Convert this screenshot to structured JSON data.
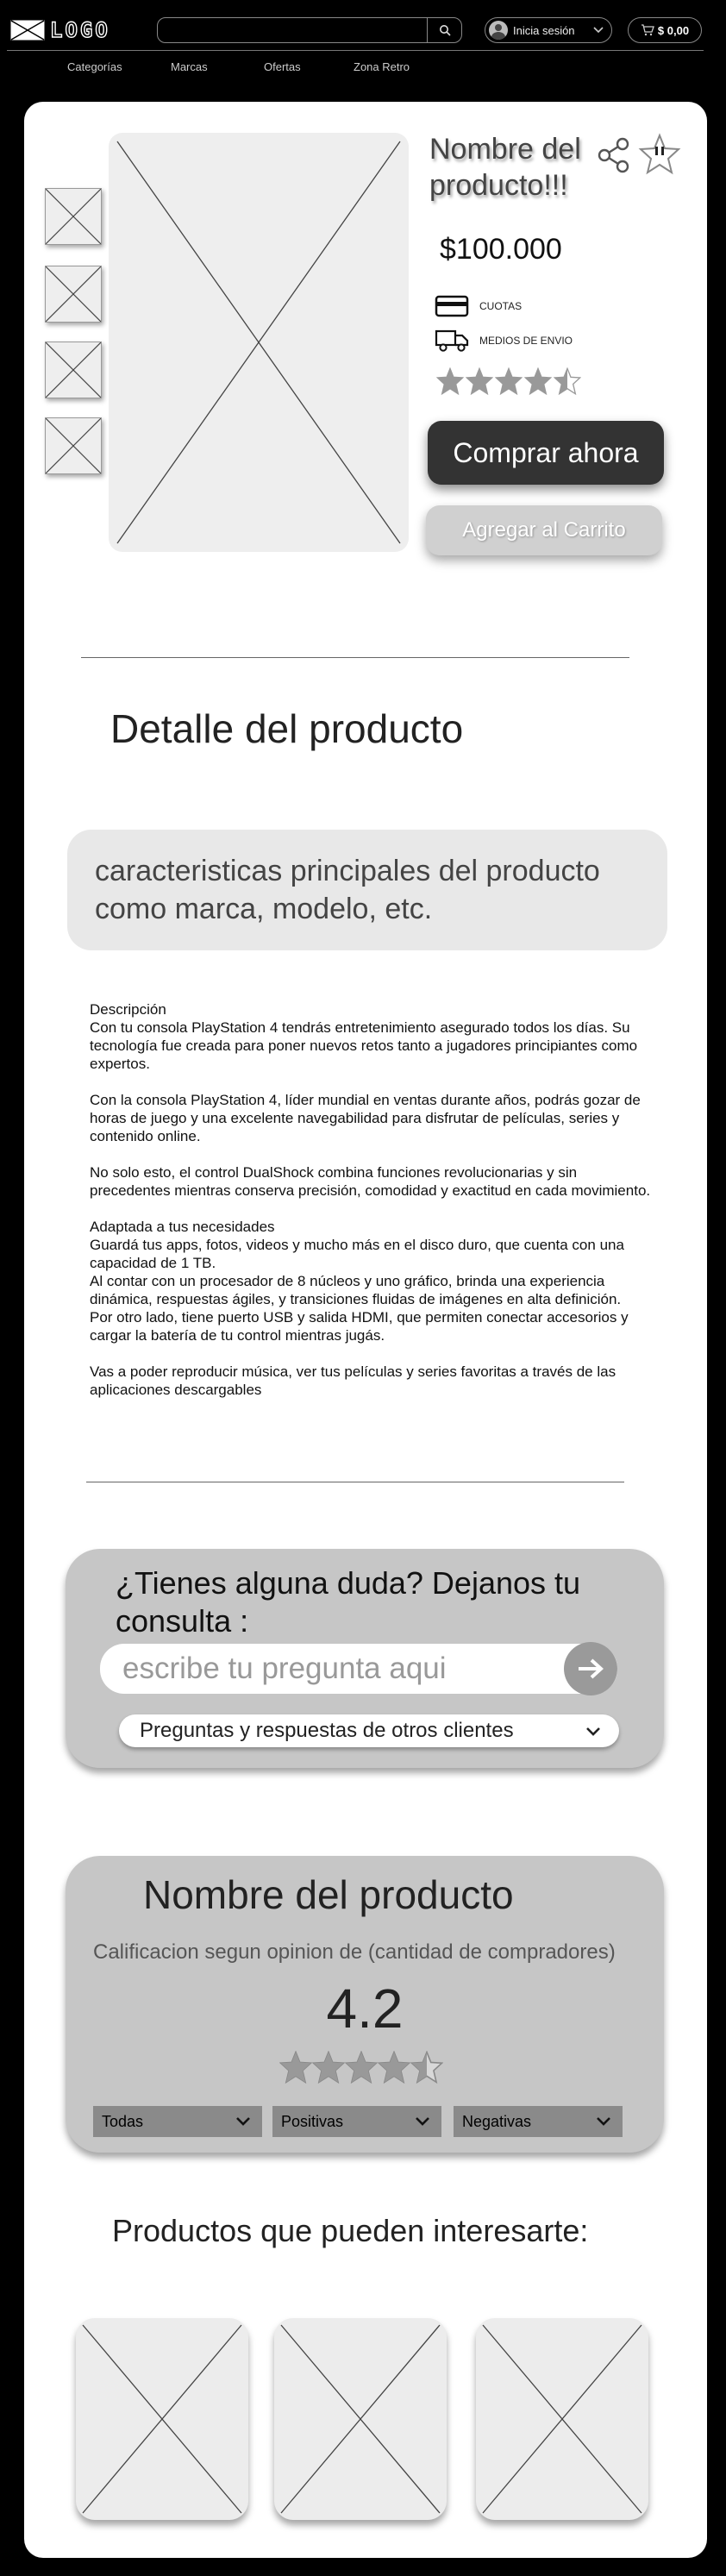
{
  "header": {
    "logo_text": "LOGO",
    "search": {
      "placeholder": ""
    },
    "login_label": "Inicia sesión",
    "cart_total": "$ 0,00",
    "nav": [
      {
        "label": "Categorías"
      },
      {
        "label": "Marcas"
      },
      {
        "label": "Ofertas"
      },
      {
        "label": "Zona Retro"
      }
    ]
  },
  "product": {
    "title": "Nombre del producto!!!",
    "price": "$100.000",
    "payment_label": "CUOTAS",
    "shipping_label": "MEDIOS DE ENVIO",
    "rating_stars": 4.5,
    "buy_label": "Comprar ahora",
    "add_to_cart_label": "Agregar al Carrito"
  },
  "detail": {
    "title": "Detalle del producto",
    "features": "caracteristicas principales del producto como marca, modelo, etc.",
    "description": "Descripción\nCon tu consola PlayStation 4 tendrás entretenimiento asegurado todos los días. Su tecnología fue creada para poner nuevos retos tanto a jugadores principiantes como expertos.\n\nCon la consola PlayStation 4, líder mundial en ventas durante años, podrás gozar de horas de juego y una excelente navegabilidad para disfrutar de películas, series y contenido online.\n\nNo solo esto, el control DualShock combina funciones revolucionarias y sin precedentes mientras conserva precisión, comodidad y exactitud en cada movimiento.\n\nAdaptada a tus necesidades\nGuardá tus apps, fotos, videos y mucho más en el disco duro, que cuenta con una capacidad de 1 TB.\nAl contar con un procesador de 8 núcleos y uno gráfico, brinda una experiencia dinámica, respuestas ágiles, y transiciones fluidas de imágenes en alta definición.\nPor otro lado, tiene puerto USB y salida HDMI, que permiten conectar accesorios y cargar la batería de tu control mientras jugás.\n\nVas a poder reproducir música, ver tus películas y series favoritas a través de las aplicaciones descargables"
  },
  "questions": {
    "title": "¿Tienes alguna duda? Dejanos tu consulta :",
    "input_placeholder": "escribe tu pregunta aqui",
    "dropdown_label": "Preguntas y respuestas de otros clientes"
  },
  "reviews": {
    "product_name": "Nombre del producto",
    "subtitle": "Calificacion segun opinion de (cantidad de compradores)",
    "score": "4.2",
    "rating_stars": 4.5,
    "filters": [
      {
        "label": "Todas"
      },
      {
        "label": "Positivas"
      },
      {
        "label": "Negativas"
      }
    ]
  },
  "suggestions": {
    "title": "Productos que pueden interesarte:"
  }
}
